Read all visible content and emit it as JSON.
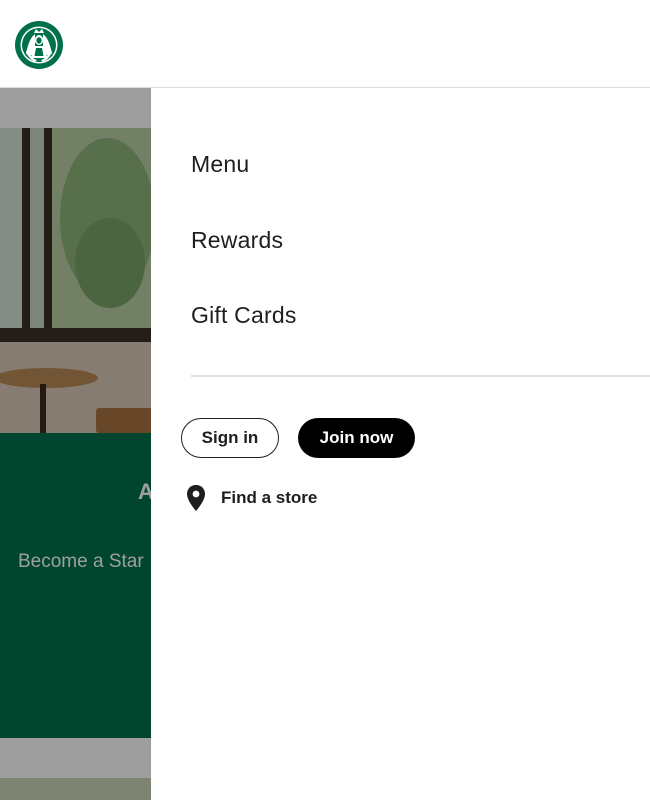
{
  "header": {
    "logo_icon": "starbucks-siren-logo-icon",
    "brand_color": "#00704A"
  },
  "background_page": {
    "heading_fragment": "A",
    "subtext_fragment": "Become a Star",
    "band_color": "#00704A"
  },
  "drawer": {
    "nav_items": [
      {
        "label": "Menu"
      },
      {
        "label": "Rewards"
      },
      {
        "label": "Gift Cards"
      }
    ],
    "signin_label": "Sign in",
    "join_label": "Join now",
    "find_store_label": "Find a store",
    "find_store_icon": "location-pin-icon"
  }
}
